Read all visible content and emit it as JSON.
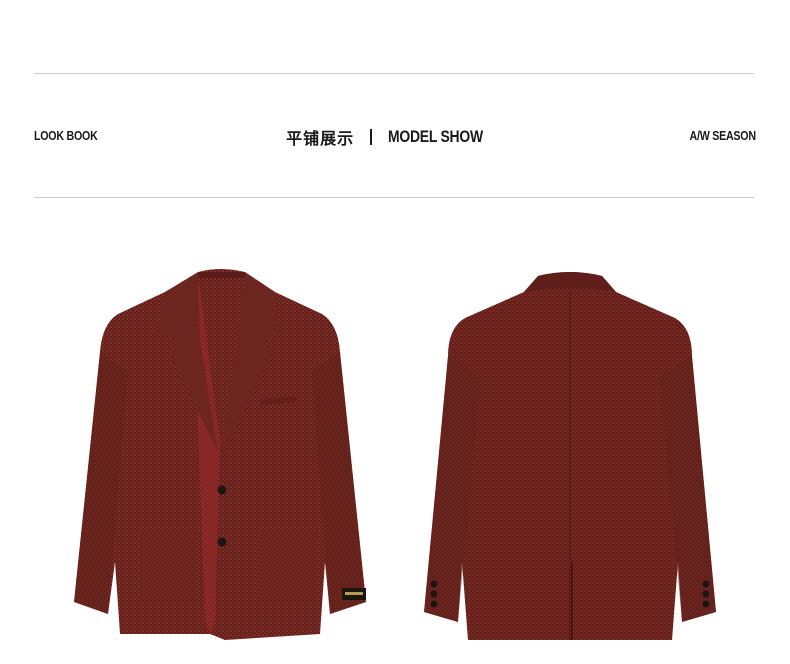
{
  "header": {
    "left_label": "LOOK BOOK",
    "center_cn": "平铺展示",
    "center_en": "MODEL SHOW",
    "right_label": "A/W SEASON"
  },
  "colors": {
    "jacket": "#7a2a24",
    "jacket_dark": "#5a1d19",
    "lining": "#b8363a",
    "rule": "#c9c9c9"
  },
  "images": {
    "front": "blazer-front-view",
    "back": "blazer-back-view"
  }
}
